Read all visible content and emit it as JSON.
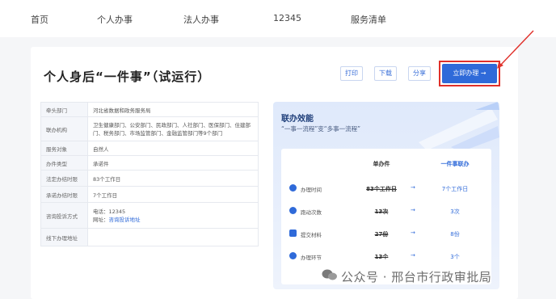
{
  "nav": {
    "items": [
      "首页",
      "个人办事",
      "法人办事",
      "12345",
      "服务清单"
    ]
  },
  "page": {
    "title": "个人身后“一件事”（试运行）",
    "buttons": {
      "print": "打印",
      "download": "下载",
      "share": "分享",
      "apply": "立即办理 →"
    }
  },
  "info": [
    {
      "k": "牵头部门",
      "v": "河北省数据和政务服务局"
    },
    {
      "k": "联办机构",
      "v": "卫生健康部门、公安部门、民政部门、人社部门、医保部门、住建部门、税务部门、市场监管部门、金融监管部门等9个部门"
    },
    {
      "k": "服务对象",
      "v": "自然人"
    },
    {
      "k": "办件类型",
      "v": "承诺件"
    },
    {
      "k": "法定办结时限",
      "v": "83个工作日"
    },
    {
      "k": "承诺办结时限",
      "v": "7个工作日"
    },
    {
      "k": "咨询投诉方式",
      "v": "电话：12345",
      "v2_label": "网址：",
      "v2_link": "咨询投诉地址"
    },
    {
      "k": "线下办理地址",
      "v": ""
    }
  ],
  "panel": {
    "title": "联办效能",
    "subtitle": "“一事一流程”变“多事一流程”",
    "col_single": "单办件",
    "col_joint": "一件事联办",
    "rows": [
      {
        "icon": "clock-icon",
        "label": "办理时间",
        "old": "83个工作日",
        "new": "7个工作日"
      },
      {
        "icon": "run-icon",
        "label": "跑动次数",
        "old": "13次",
        "new": "3次"
      },
      {
        "icon": "folder-icon",
        "label": "提交材料",
        "old": "27份",
        "new": "8份"
      },
      {
        "icon": "link-icon",
        "label": "办理环节",
        "old": "13个",
        "new": "3个"
      }
    ],
    "arrow": "→"
  },
  "watermark": "公众号 · 邢台市行政审批局",
  "colors": {
    "accent": "#2f6ad9",
    "highlight": "#e0302a"
  }
}
